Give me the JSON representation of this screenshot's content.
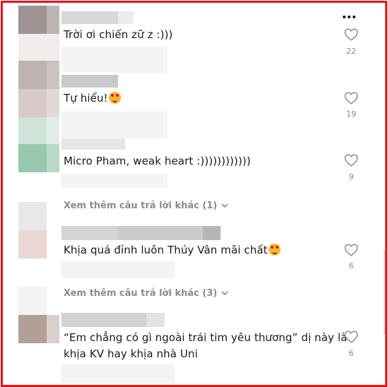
{
  "comments": [
    {
      "text": "Trời ơi chiến zữ z :)))",
      "likes": "22",
      "emoji": false
    },
    {
      "text": "Tự hiểu!",
      "likes": "19",
      "emoji": true
    },
    {
      "text": "Micro Pham, weak heart :))))))))))))",
      "likes": "9",
      "emoji": false
    },
    {
      "text": "Khịa quá đỉnh luôn Thúy Vân mãi chất",
      "likes": "6",
      "emoji": true
    },
    {
      "text_line1": "“Em chẳng có gì ngoài trái tim yêu thương” dị này là",
      "text_line2": "khịa KV hay khịa nhà Uni",
      "likes": "6",
      "emoji": false
    }
  ],
  "view_more": [
    {
      "label": "Xem thêm câu trả lời khác (1)"
    },
    {
      "label": "Xem thêm câu trả lời khác (3)"
    }
  ],
  "icons": {
    "like": "heart-outline-icon",
    "more": "ellipsis-icon",
    "expand": "chevron-down-icon",
    "emoji": "smiling-face-with-hearts-icon"
  },
  "colors": {
    "border": "#e8141b",
    "text": "#161823",
    "muted": "#8a8b91"
  }
}
